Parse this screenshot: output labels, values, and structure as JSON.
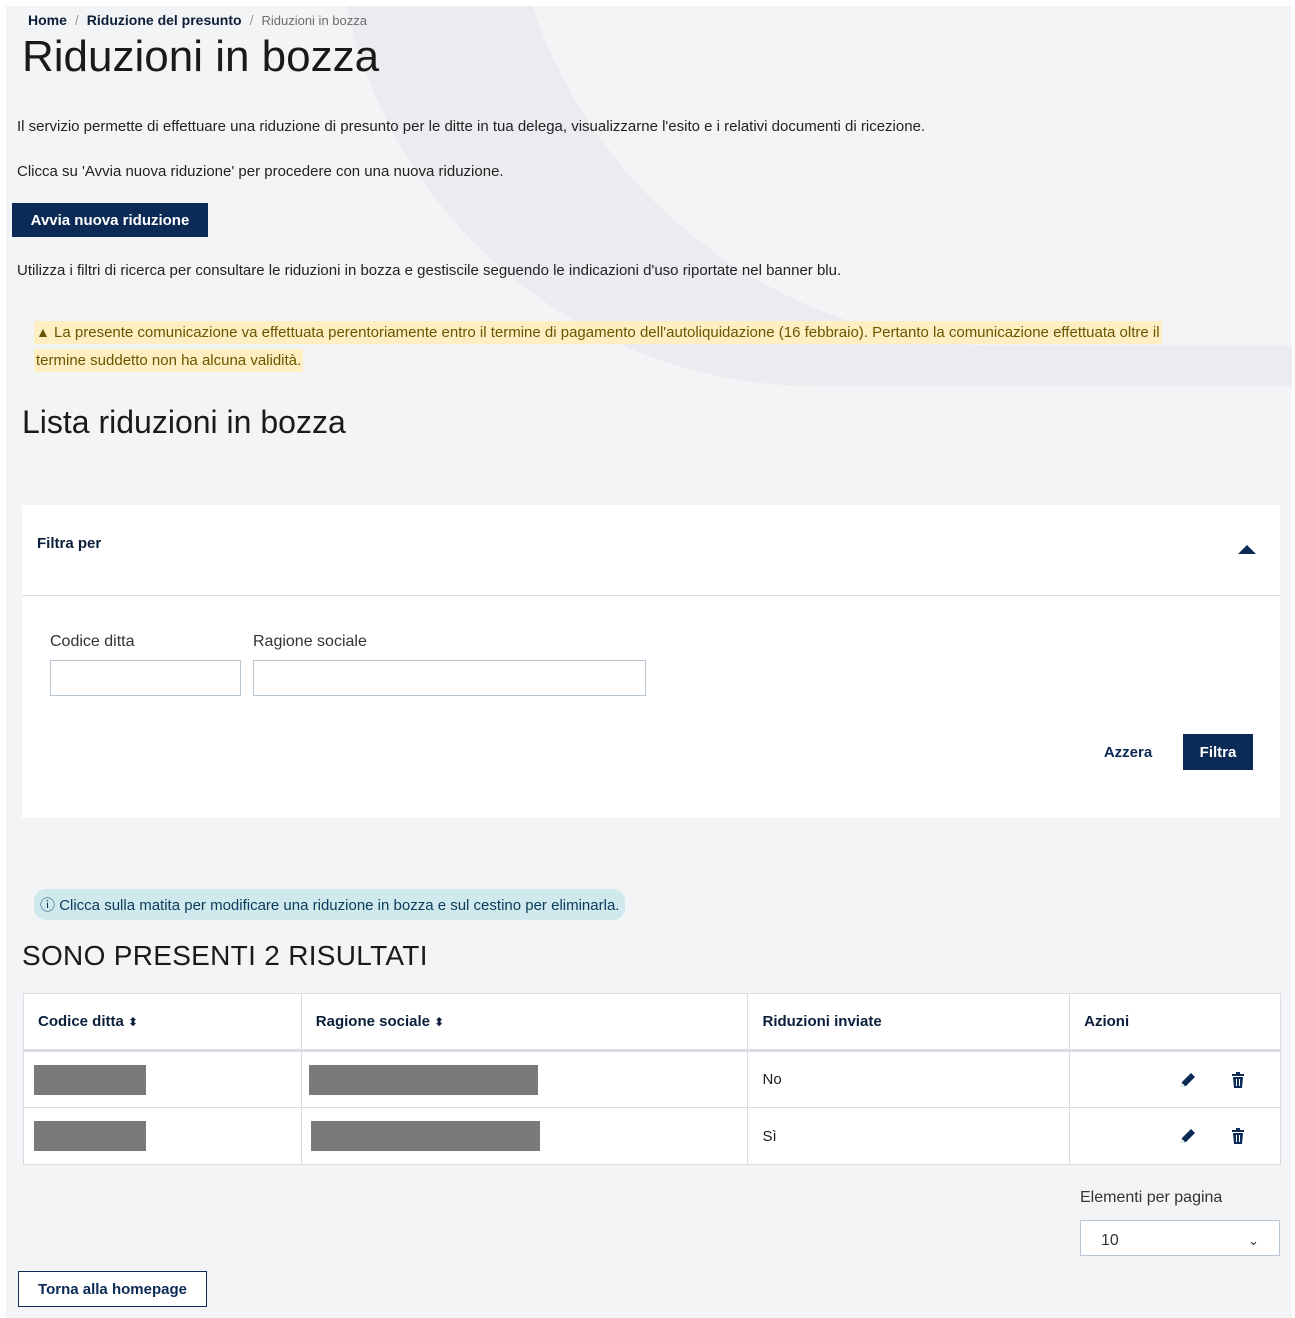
{
  "breadcrumb": {
    "home": "Home",
    "parent": "Riduzione del presunto",
    "current": "Riduzioni in bozza",
    "sep": "/"
  },
  "page_title": "Riduzioni in bozza",
  "intro_1": "Il servizio permette di effettuare una riduzione di presunto per le ditte in tua delega, visualizzarne l'esito e i relativi documenti di ricezione.",
  "intro_2": "Clicca su 'Avvia nuova riduzione' per procedere con una nuova riduzione.",
  "new_button": "Avvia nuova riduzione",
  "intro_3": "Utilizza i filtri di ricerca per consultare le riduzioni in bozza e gestiscile seguendo le indicazioni d'uso riportate nel banner blu.",
  "warning": "La presente comunicazione va effettuata perentoriamente entro il termine di pagamento dell'autoliquidazione (16 febbraio). Pertanto la comunicazione effettuata oltre il termine suddetto non ha alcuna validità.",
  "list_title": "Lista riduzioni in bozza",
  "filter": {
    "header": "Filtra per",
    "field_codice": "Codice ditta",
    "field_ragione": "Ragione sociale",
    "codice_value": "",
    "ragione_value": "",
    "reset": "Azzera",
    "submit": "Filtra"
  },
  "info": "Clicca sulla matita per modificare una riduzione in bozza e sul cestino per eliminarla.",
  "results_title": "SONO PRESENTI 2 RISULTATI",
  "table": {
    "headers": [
      "Codice ditta",
      "Ragione sociale",
      "Riduzioni inviate",
      "Azioni"
    ],
    "rows": [
      {
        "inviate": "No"
      },
      {
        "inviate": "Sì"
      }
    ]
  },
  "pagination": {
    "label": "Elementi per pagina",
    "value": "10"
  },
  "back_button": "Torna alla homepage",
  "colors": {
    "primary": "#0b2a55",
    "warning_bg": "#fdefc2",
    "info_bg": "#cfe9ec",
    "page_bg": "#f3f4f6"
  }
}
